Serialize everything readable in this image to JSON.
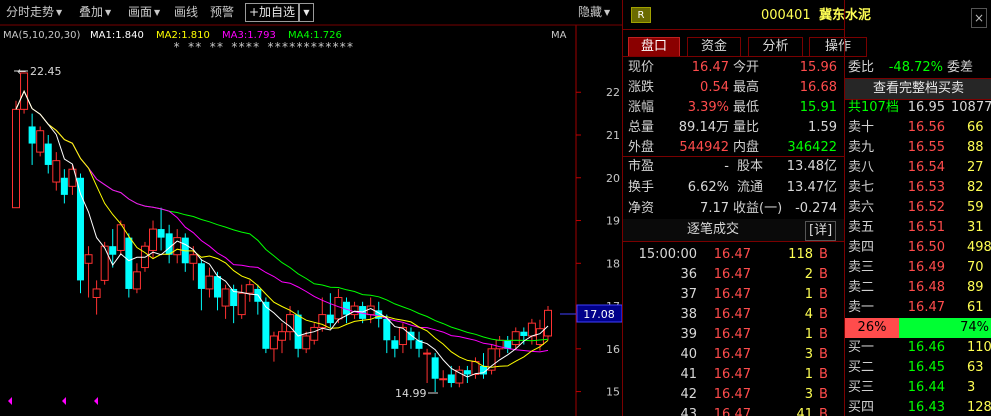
{
  "toolbar": {
    "items": [
      "分时走势",
      "叠加",
      "画面",
      "画线",
      "预警"
    ],
    "add_fav": "+加自选",
    "hide": "隐藏"
  },
  "ma_legend": {
    "base": "MA(5,10,20,30)",
    "ma1": "MA1:1.840",
    "ma2": "MA2:1.810",
    "ma3": "MA3:1.793",
    "ma4": "MA4:1.726",
    "ma_right": "MA",
    "stars": "*  **  **  ****    ************"
  },
  "chart_data": {
    "type": "candlestick",
    "y_axis_ticks": [
      "22",
      "21",
      "20",
      "19",
      "18",
      "17",
      "16",
      "15"
    ],
    "ylim": [
      14.6,
      23.2
    ],
    "current_price_tag": "17.08",
    "high_label": "22.45",
    "low_label": "14.99",
    "candles": [
      [
        19.3,
        21.6,
        19.3,
        21.8
      ],
      [
        21.6,
        22.45,
        21.5,
        22.45
      ],
      [
        21.2,
        20.8,
        20.3,
        21.5
      ],
      [
        20.6,
        21.1,
        20.5,
        21.2
      ],
      [
        20.8,
        20.3,
        20.1,
        21.0
      ],
      [
        19.9,
        20.4,
        19.7,
        20.6
      ],
      [
        20.0,
        19.6,
        19.4,
        20.2
      ],
      [
        19.8,
        20.2,
        19.6,
        20.3
      ],
      [
        20.0,
        17.6,
        17.3,
        20.1
      ],
      [
        18.0,
        18.2,
        17.2,
        18.4
      ],
      [
        17.2,
        17.4,
        16.8,
        17.6
      ],
      [
        17.6,
        18.4,
        17.5,
        18.5
      ],
      [
        18.4,
        18.2,
        17.9,
        18.8
      ],
      [
        18.3,
        18.9,
        18.2,
        19.0
      ],
      [
        18.6,
        17.4,
        17.2,
        18.7
      ],
      [
        17.4,
        17.8,
        17.3,
        18.0
      ],
      [
        17.9,
        18.4,
        17.8,
        18.5
      ],
      [
        18.3,
        18.8,
        18.1,
        19.0
      ],
      [
        18.8,
        18.6,
        18.3,
        19.3
      ],
      [
        18.7,
        18.2,
        18.0,
        18.9
      ],
      [
        18.2,
        18.6,
        18.0,
        18.8
      ],
      [
        18.6,
        18.0,
        17.8,
        18.7
      ],
      [
        18.0,
        18.2,
        17.6,
        18.4
      ],
      [
        18.0,
        17.4,
        16.9,
        18.1
      ],
      [
        17.4,
        17.7,
        17.2,
        17.9
      ],
      [
        17.7,
        17.2,
        16.9,
        17.8
      ],
      [
        17.0,
        17.4,
        16.7,
        17.5
      ],
      [
        17.4,
        17.0,
        16.6,
        17.5
      ],
      [
        16.8,
        17.3,
        16.7,
        17.5
      ],
      [
        17.3,
        17.5,
        17.1,
        17.6
      ],
      [
        17.4,
        17.1,
        16.8,
        17.5
      ],
      [
        17.1,
        16.0,
        15.9,
        17.2
      ],
      [
        16.0,
        16.3,
        15.7,
        16.4
      ],
      [
        16.2,
        16.4,
        15.9,
        16.6
      ],
      [
        16.4,
        16.8,
        16.2,
        17.0
      ],
      [
        16.8,
        16.0,
        15.8,
        16.9
      ],
      [
        16.0,
        16.3,
        15.9,
        16.4
      ],
      [
        16.2,
        16.5,
        16.1,
        16.6
      ],
      [
        16.5,
        16.8,
        16.4,
        17.2
      ],
      [
        16.8,
        16.6,
        16.5,
        17.3
      ],
      [
        16.7,
        17.2,
        16.6,
        17.4
      ],
      [
        17.1,
        16.8,
        16.6,
        17.2
      ],
      [
        16.8,
        17.0,
        16.7,
        17.1
      ],
      [
        17.0,
        16.7,
        16.6,
        17.1
      ],
      [
        16.8,
        17.0,
        16.6,
        17.2
      ],
      [
        16.9,
        16.7,
        16.5,
        17.1
      ],
      [
        16.7,
        16.2,
        15.9,
        16.8
      ],
      [
        16.2,
        16.0,
        15.8,
        16.3
      ],
      [
        16.1,
        16.5,
        15.9,
        16.6
      ],
      [
        16.4,
        16.2,
        16.0,
        16.5
      ],
      [
        16.2,
        16.0,
        15.8,
        16.4
      ],
      [
        15.9,
        15.9,
        15.2,
        16.0
      ],
      [
        15.8,
        15.3,
        14.99,
        15.9
      ],
      [
        15.3,
        15.3,
        15.1,
        15.5
      ],
      [
        15.4,
        15.2,
        15.1,
        15.6
      ],
      [
        15.2,
        15.5,
        15.1,
        15.6
      ],
      [
        15.5,
        15.4,
        15.2,
        15.6
      ],
      [
        15.4,
        15.7,
        15.3,
        15.8
      ],
      [
        15.6,
        15.4,
        15.3,
        15.9
      ],
      [
        15.5,
        16.0,
        15.4,
        16.1
      ],
      [
        16.0,
        16.2,
        15.8,
        16.3
      ],
      [
        16.2,
        16.0,
        15.9,
        16.3
      ],
      [
        16.1,
        16.4,
        16.0,
        16.5
      ],
      [
        16.4,
        16.3,
        16.1,
        16.5
      ],
      [
        16.3,
        16.6,
        16.1,
        16.7
      ],
      [
        16.1,
        16.47,
        15.96,
        16.68
      ],
      [
        16.3,
        16.9,
        16.2,
        17.0
      ]
    ],
    "ma_colors": {
      "ma5": "#ffffff",
      "ma10": "#ffff00",
      "ma20": "#ff00ff",
      "ma30": "#00ff00"
    }
  },
  "stock": {
    "badge": "R",
    "code": "000401",
    "name": "冀东水泥"
  },
  "tabs": [
    "盘口",
    "资金",
    "分析",
    "操作"
  ],
  "quote_rows": [
    {
      "l1": "现价",
      "v1": "16.47",
      "c1": "r",
      "l2": "今开",
      "v2": "15.96",
      "c2": "r"
    },
    {
      "l1": "涨跌",
      "v1": "0.54",
      "c1": "r",
      "l2": "最高",
      "v2": "16.68",
      "c2": "r"
    },
    {
      "l1": "涨幅",
      "v1": "3.39%",
      "c1": "r",
      "l2": "最低",
      "v2": "15.91",
      "c2": "g"
    },
    {
      "l1": "总量",
      "v1": "89.14万",
      "c1": "w",
      "l2": "量比",
      "v2": "1.59",
      "c2": "w"
    },
    {
      "l1": "外盘",
      "v1": "544942",
      "c1": "r",
      "l2": "内盘",
      "v2": "346422",
      "c2": "g"
    }
  ],
  "fund_rows": [
    {
      "l1": "市盈",
      "v1": "-",
      "l2": "股本",
      "v2": "13.48亿"
    },
    {
      "l1": "换手",
      "v1": "6.62%",
      "l2": "流通",
      "v2": "13.47亿"
    },
    {
      "l1": "净资",
      "v1": "7.17",
      "l2": "收益(一)",
      "v2": "-0.274"
    }
  ],
  "ticks_header": {
    "title": "逐笔成交",
    "detail": "详"
  },
  "ticks": [
    {
      "time": "15:00:00",
      "price": "16.47",
      "vol": "118",
      "side": "B"
    },
    {
      "time": "36",
      "price": "16.47",
      "vol": "2",
      "side": "B"
    },
    {
      "time": "37",
      "price": "16.47",
      "vol": "1",
      "side": "B"
    },
    {
      "time": "38",
      "price": "16.47",
      "vol": "4",
      "side": "B"
    },
    {
      "time": "39",
      "price": "16.47",
      "vol": "1",
      "side": "B"
    },
    {
      "time": "40",
      "price": "16.47",
      "vol": "3",
      "side": "B"
    },
    {
      "time": "41",
      "price": "16.47",
      "vol": "1",
      "side": "B"
    },
    {
      "time": "42",
      "price": "16.47",
      "vol": "3",
      "side": "B"
    },
    {
      "time": "43",
      "price": "16.47",
      "vol": "41",
      "side": "B"
    }
  ],
  "order_book": {
    "weibi_label": "委比",
    "weibi_value": "-48.72%",
    "weicha_label": "委差",
    "full_book": "查看完整档买卖",
    "total_label": "共107档",
    "total_price": "16.95",
    "total_vol": "10877",
    "sells": [
      {
        "label": "卖十",
        "price": "16.56",
        "vol": "66"
      },
      {
        "label": "卖九",
        "price": "16.55",
        "vol": "88"
      },
      {
        "label": "卖八",
        "price": "16.54",
        "vol": "27"
      },
      {
        "label": "卖七",
        "price": "16.53",
        "vol": "82"
      },
      {
        "label": "卖六",
        "price": "16.52",
        "vol": "59"
      },
      {
        "label": "卖五",
        "price": "16.51",
        "vol": "31"
      },
      {
        "label": "卖四",
        "price": "16.50",
        "vol": "498"
      },
      {
        "label": "卖三",
        "price": "16.49",
        "vol": "70"
      },
      {
        "label": "卖二",
        "price": "16.48",
        "vol": "89"
      },
      {
        "label": "卖一",
        "price": "16.47",
        "vol": "61"
      }
    ],
    "ratio_red": "26%",
    "ratio_green": "74%",
    "buys": [
      {
        "label": "买一",
        "price": "16.46",
        "vol": "110"
      },
      {
        "label": "买二",
        "price": "16.45",
        "vol": "63"
      },
      {
        "label": "买三",
        "price": "16.44",
        "vol": "3"
      },
      {
        "label": "买四",
        "price": "16.43",
        "vol": "128"
      }
    ]
  }
}
